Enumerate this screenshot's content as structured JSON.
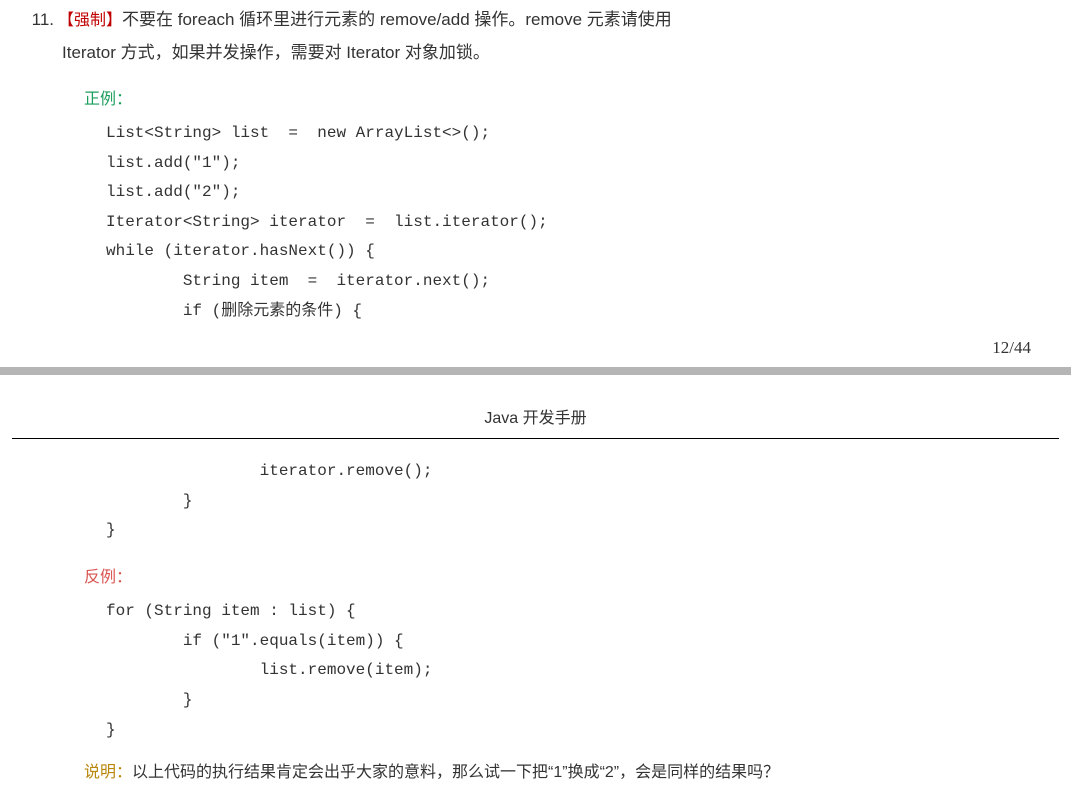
{
  "item": {
    "number": "11.",
    "tag": "【强制】",
    "rule_part1": "不要在 foreach 循环里进行元素的 remove/add 操作。remove 元素请使用",
    "rule_part2": "Iterator 方式，如果并发操作，需要对 Iterator 对象加锁。"
  },
  "positive_label": "正例：",
  "positive_code_top": "List<String> list  =  new ArrayList<>();\nlist.add(\"1\");\nlist.add(\"2\");\nIterator<String> iterator  =  list.iterator();\nwhile (iterator.hasNext()) {\n        String item  =  iterator.next();\n        if (删除元素的条件) {",
  "page_number": "12/44",
  "header_title": "Java 开发手册",
  "positive_code_bottom": "                iterator.remove();\n        }\n}",
  "negative_label": "反例：",
  "negative_code": "for (String item : list) {\n        if (\"1\".equals(item)) {\n                list.remove(item);\n        }\n}",
  "explain_label": "说明：",
  "explain_text": "以上代码的执行结果肯定会出乎大家的意料，那么试一下把“1”换成“2”，会是同样的结果吗？"
}
